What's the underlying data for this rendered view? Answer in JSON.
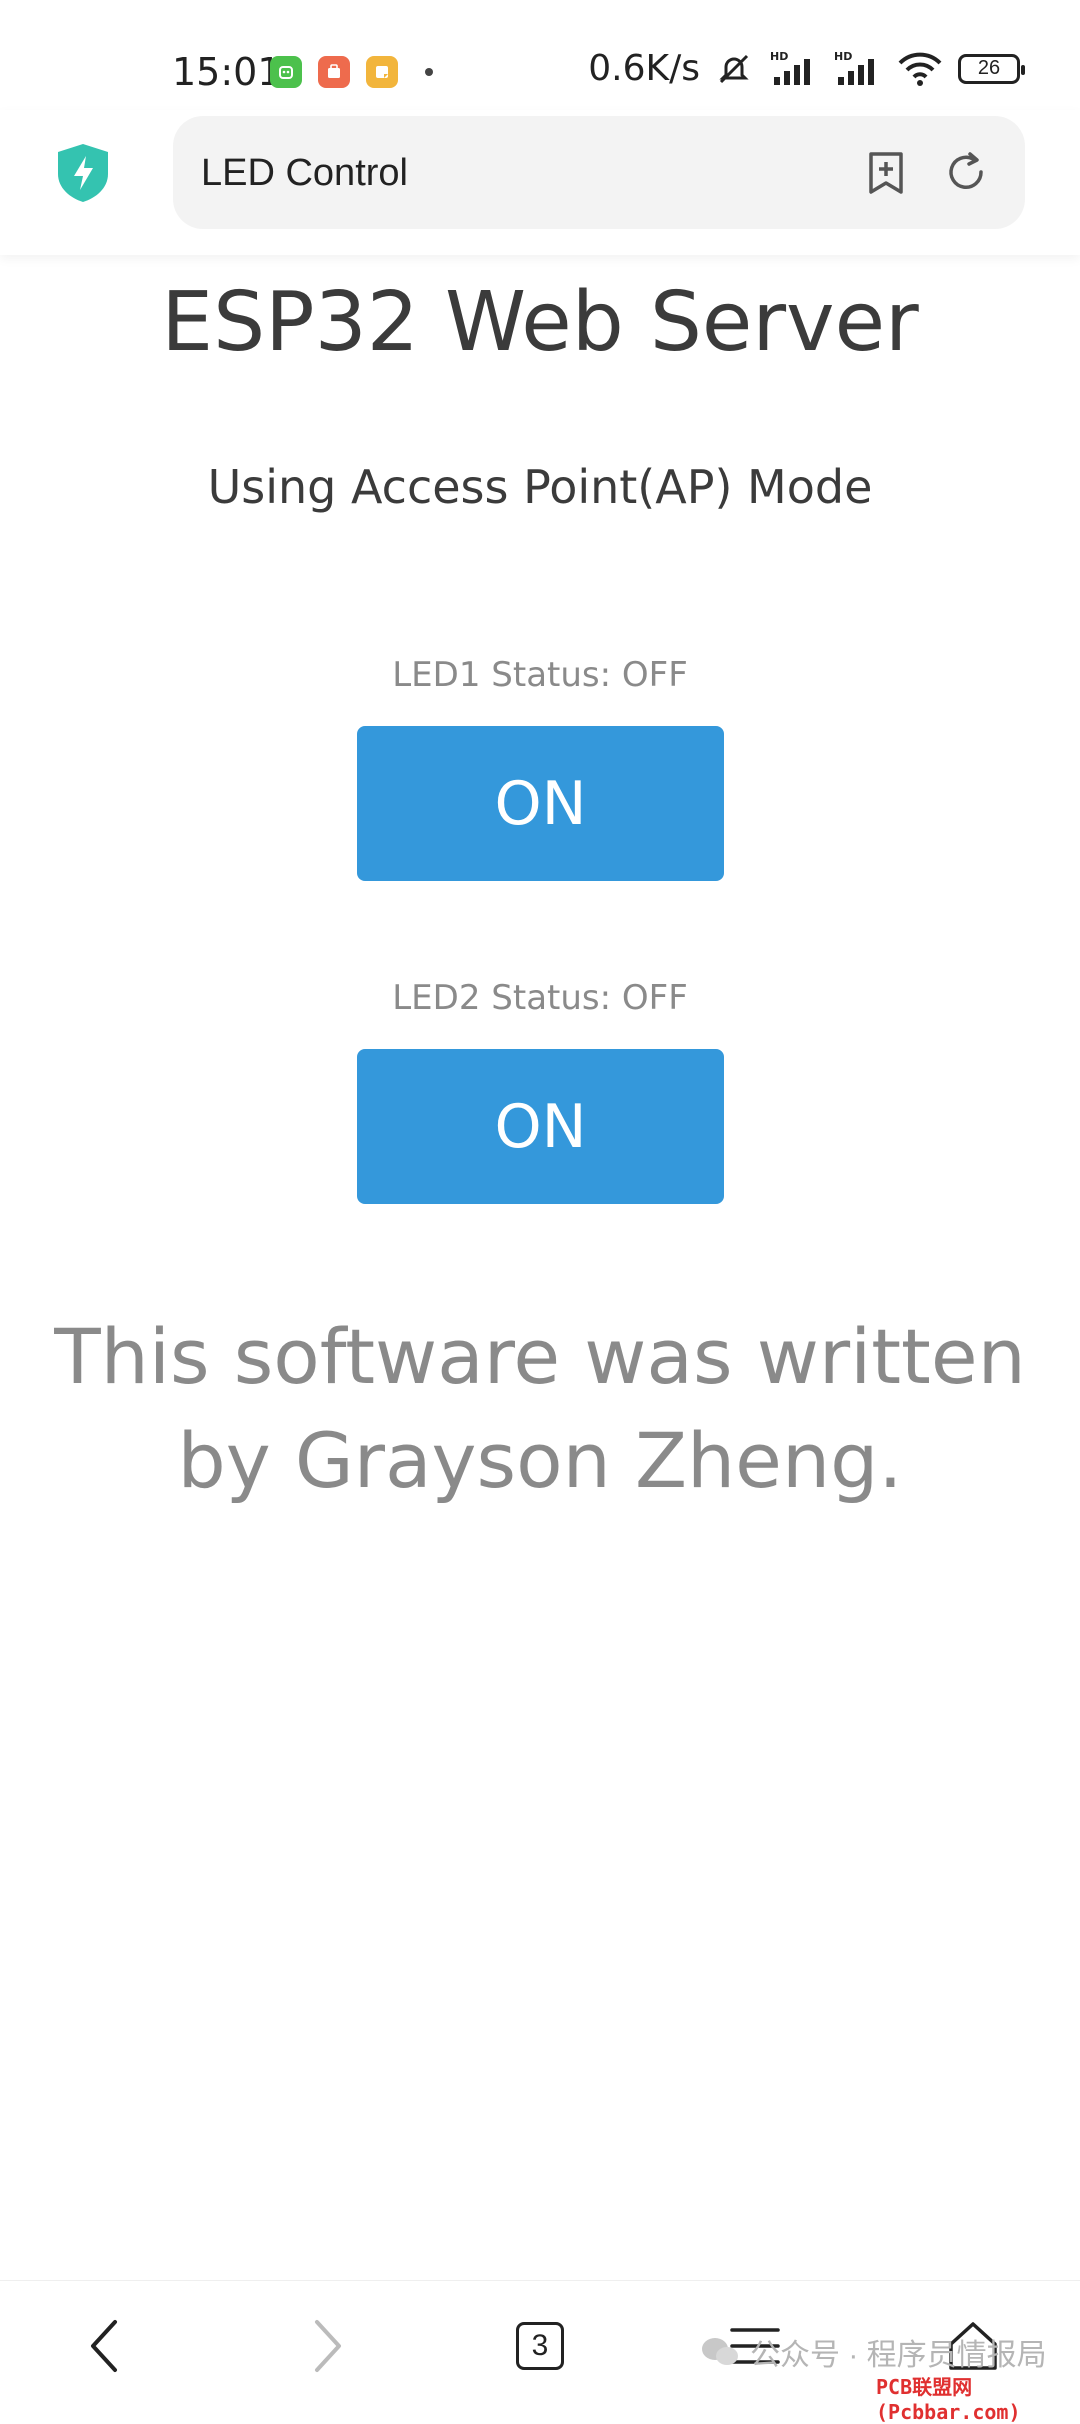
{
  "status_bar": {
    "time": "15:01",
    "net_speed": "0.6K/s",
    "battery": "26",
    "net_labels": [
      "HD",
      "HD"
    ]
  },
  "browser": {
    "address_text": "LED Control",
    "tab_count": "3"
  },
  "page": {
    "title": "ESP32 Web Server",
    "subtitle": "Using Access Point(AP) Mode",
    "led1": {
      "status": "LED1 Status: OFF",
      "button": "ON"
    },
    "led2": {
      "status": "LED2 Status: OFF",
      "button": "ON"
    },
    "footer_line1": "This software was written",
    "footer_line2": "by Grayson Zheng."
  },
  "watermark": {
    "text": "公众号 · 程序员情报局",
    "site": "PCB联盟网 (Pcbbar.com)"
  },
  "colors": {
    "button_bg": "#3498db",
    "shield": "#34c3b0"
  }
}
